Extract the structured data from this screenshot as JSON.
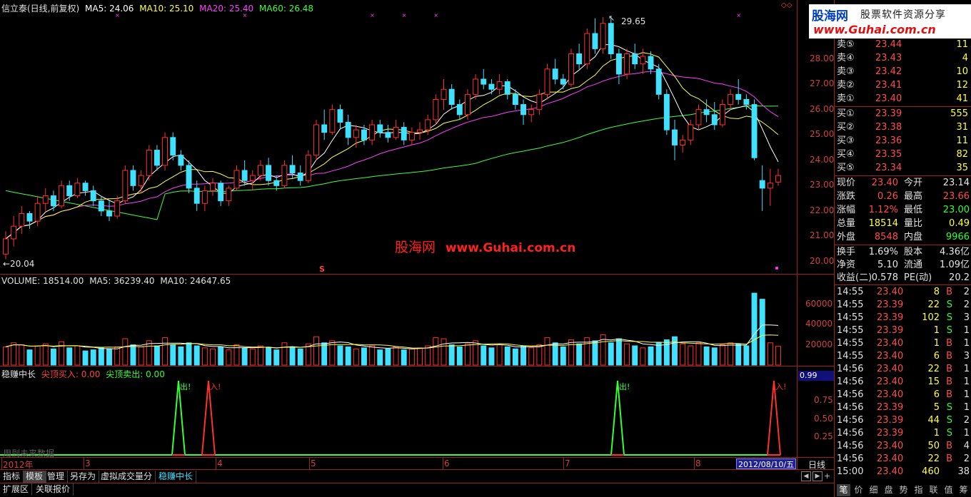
{
  "main_header": {
    "stock_label": "信立泰(日线,前复权)",
    "ma5": "MA5: 24.06",
    "ma10": "MA10: 25.10",
    "ma20": "MA20: 25.40",
    "ma60": "MA60: 26.48"
  },
  "price_annotations": {
    "high": "29.65",
    "low": "←20.04",
    "s_mark": "S"
  },
  "price_axis": [
    "29.00",
    "28.00",
    "27.00",
    "26.00",
    "25.00",
    "24.00",
    "23.00",
    "22.00",
    "21.00",
    "20.00"
  ],
  "volume_header": {
    "volume": "VOLUME: 18514.00",
    "ma5": "MA5: 36239.40",
    "ma10": "MA10: 24647.65"
  },
  "volume_axis": [
    "60000",
    "40000",
    "20000"
  ],
  "indicator_header": {
    "name": "稳赚中长",
    "buy": "尖顶买入: 0.00",
    "sell": "尖顶卖出: 0.00"
  },
  "indicator_axis": {
    "value_box": "0.99",
    "ticks": [
      "0.75",
      "0.50",
      "0.25"
    ]
  },
  "indicator_marks": {
    "out1": "出!",
    "in1": "入!",
    "out2": "出!",
    "in2": "入!"
  },
  "future_data_note": "用到未来数据",
  "date_axis": [
    "2012年",
    "3",
    "4",
    "5",
    "6",
    "7",
    "8"
  ],
  "current_date": "2012/08/10/五",
  "period": "日线",
  "watermark": {
    "cn": "股海网",
    "url": "www.Guhai.com.cn"
  },
  "logo": {
    "brand": "股海网",
    "slogan": "股票软件资源分享",
    "url": "www.Guhai.com.cn"
  },
  "order_book": {
    "sells": [
      {
        "label": "卖⑤",
        "price": "23.44",
        "vol": "11"
      },
      {
        "label": "卖④",
        "price": "23.43",
        "vol": "4"
      },
      {
        "label": "卖③",
        "price": "23.42",
        "vol": "10"
      },
      {
        "label": "卖②",
        "price": "23.41",
        "vol": "12"
      },
      {
        "label": "卖①",
        "price": "23.40",
        "vol": "41"
      }
    ],
    "buys": [
      {
        "label": "买①",
        "price": "23.39",
        "vol": "555"
      },
      {
        "label": "买②",
        "price": "23.38",
        "vol": "31"
      },
      {
        "label": "买③",
        "price": "23.36",
        "vol": "11"
      },
      {
        "label": "买④",
        "price": "23.35",
        "vol": "82"
      },
      {
        "label": "买⑤",
        "price": "23.34",
        "vol": "35"
      }
    ]
  },
  "quote": [
    {
      "l1": "现价",
      "v1": "23.40",
      "l2": "今开",
      "v2": "23.14",
      "c1": "red",
      "c2": "wht"
    },
    {
      "l1": "涨跌",
      "v1": "0.26",
      "l2": "最高",
      "v2": "23.66",
      "c1": "red",
      "c2": "red"
    },
    {
      "l1": "涨幅",
      "v1": "1.12%",
      "l2": "最低",
      "v2": "23.00",
      "c1": "red",
      "c2": "grn"
    },
    {
      "l1": "总量",
      "v1": "18514",
      "l2": "量比",
      "v2": "0.49",
      "c1": "yel",
      "c2": "yel"
    },
    {
      "l1": "外盘",
      "v1": "8548",
      "l2": "内盘",
      "v2": "9966",
      "c1": "red",
      "c2": "grn"
    }
  ],
  "fundamentals": [
    {
      "l1": "换手",
      "v1": "1.69%",
      "l2": "股本",
      "v2": "4.36亿"
    },
    {
      "l1": "净资",
      "v1": "5.10",
      "l2": "流通",
      "v2": "1.09亿"
    },
    {
      "l1": "收益(二)",
      "v1": "0.578",
      "l2": "PE(动)",
      "v2": "20.2"
    }
  ],
  "ticks": [
    {
      "t": "14:55",
      "p": "23.40",
      "v": "8",
      "s": "B",
      "n": "2",
      "pc": "red"
    },
    {
      "t": "14:55",
      "p": "23.39",
      "v": "22",
      "s": "S",
      "n": "2",
      "pc": "red"
    },
    {
      "t": "14:55",
      "p": "23.39",
      "v": "102",
      "s": "S",
      "n": "3",
      "pc": "red"
    },
    {
      "t": "14:55",
      "p": "23.39",
      "v": "1",
      "s": "S",
      "n": "1",
      "pc": "red"
    },
    {
      "t": "14:55",
      "p": "23.40",
      "v": "1",
      "s": "B",
      "n": "1",
      "pc": "red"
    },
    {
      "t": "14:55",
      "p": "23.40",
      "v": "6",
      "s": "B",
      "n": "3",
      "pc": "red"
    },
    {
      "t": "14:56",
      "p": "23.40",
      "v": "22",
      "s": "B",
      "n": "1",
      "pc": "red"
    },
    {
      "t": "14:56",
      "p": "23.40",
      "v": "15",
      "s": "B",
      "n": "1",
      "pc": "red"
    },
    {
      "t": "14:56",
      "p": "23.40",
      "v": "6",
      "s": "B",
      "n": "1",
      "pc": "red"
    },
    {
      "t": "14:56",
      "p": "23.39",
      "v": "5",
      "s": "S",
      "n": "1",
      "pc": "red"
    },
    {
      "t": "14:56",
      "p": "23.39",
      "v": "44",
      "s": "S",
      "n": "2",
      "pc": "red"
    },
    {
      "t": "14:56",
      "p": "23.39",
      "v": "1",
      "s": "S",
      "n": "1",
      "pc": "red"
    },
    {
      "t": "14:56",
      "p": "23.40",
      "v": "50",
      "s": "B",
      "n": "4",
      "pc": "red"
    },
    {
      "t": "14:56",
      "p": "23.40",
      "v": "22",
      "s": "B",
      "n": "2",
      "pc": "red"
    },
    {
      "t": "15:00",
      "p": "23.40",
      "v": "460",
      "s": "",
      "n": "38",
      "pc": "red"
    }
  ],
  "bottom_tabs": [
    "指标",
    "模板",
    "管理",
    "另存为",
    "虚拟成交量分",
    "稳赚中长"
  ],
  "bottom_tabs2": [
    "扩展区",
    "关联报价"
  ],
  "right_tabs": [
    "笔",
    "价",
    "细",
    "盘",
    "势",
    "指",
    "联",
    "值",
    "筹"
  ],
  "colors": {
    "up": "#ff3030",
    "down": "#40e0ff",
    "ma5": "#ffffff",
    "ma10": "#ffff40",
    "ma20": "#ff40ff",
    "ma60": "#40ff40",
    "grid": "#a02020"
  },
  "chart_data": {
    "type": "candlestick",
    "ylim": [
      19.6,
      30.0
    ],
    "candles": [
      [
        20.3,
        21.2,
        20.1,
        20.9
      ],
      [
        20.9,
        21.8,
        20.6,
        21.4
      ],
      [
        21.4,
        22.2,
        21.1,
        21.9
      ],
      [
        21.9,
        22.0,
        21.3,
        21.6
      ],
      [
        21.6,
        22.6,
        21.4,
        22.3
      ],
      [
        22.3,
        22.9,
        22.0,
        22.6
      ],
      [
        22.6,
        22.8,
        22.0,
        22.2
      ],
      [
        22.2,
        23.2,
        22.1,
        23.0
      ],
      [
        23.0,
        23.2,
        22.4,
        22.6
      ],
      [
        22.6,
        23.3,
        22.5,
        23.1
      ],
      [
        23.1,
        23.2,
        22.6,
        22.8
      ],
      [
        22.8,
        23.0,
        22.2,
        22.4
      ],
      [
        22.4,
        22.6,
        21.8,
        22.0
      ],
      [
        22.0,
        22.4,
        21.6,
        21.8
      ],
      [
        21.8,
        22.6,
        21.7,
        22.4
      ],
      [
        22.4,
        23.8,
        22.3,
        23.6
      ],
      [
        23.6,
        23.8,
        22.8,
        23.0
      ],
      [
        23.0,
        23.6,
        22.7,
        23.4
      ],
      [
        23.4,
        24.6,
        23.2,
        24.4
      ],
      [
        24.4,
        24.6,
        23.6,
        23.8
      ],
      [
        23.8,
        25.1,
        23.6,
        24.9
      ],
      [
        24.9,
        25.1,
        24.0,
        24.2
      ],
      [
        24.2,
        24.4,
        23.6,
        23.8
      ],
      [
        23.8,
        24.0,
        22.7,
        22.9
      ],
      [
        22.9,
        23.2,
        22.0,
        22.3
      ],
      [
        22.3,
        23.0,
        22.0,
        22.8
      ],
      [
        22.8,
        23.3,
        22.6,
        23.1
      ],
      [
        23.1,
        23.2,
        22.2,
        22.4
      ],
      [
        22.4,
        23.0,
        22.2,
        22.9
      ],
      [
        22.9,
        23.8,
        22.8,
        23.6
      ],
      [
        23.6,
        24.0,
        23.0,
        23.2
      ],
      [
        23.2,
        23.6,
        22.8,
        23.4
      ],
      [
        23.4,
        24.0,
        23.2,
        23.8
      ],
      [
        23.8,
        24.1,
        23.0,
        23.2
      ],
      [
        23.2,
        23.4,
        22.8,
        23.0
      ],
      [
        23.0,
        24.0,
        22.9,
        23.8
      ],
      [
        23.8,
        24.2,
        23.3,
        23.5
      ],
      [
        23.5,
        23.8,
        23.0,
        23.2
      ],
      [
        23.2,
        24.4,
        23.1,
        24.2
      ],
      [
        24.2,
        25.6,
        24.0,
        25.4
      ],
      [
        25.4,
        26.0,
        24.8,
        25.1
      ],
      [
        25.1,
        26.2,
        25.0,
        26.0
      ],
      [
        26.0,
        26.2,
        25.2,
        25.5
      ],
      [
        25.5,
        25.8,
        24.6,
        24.9
      ],
      [
        24.9,
        25.4,
        24.5,
        25.2
      ],
      [
        25.2,
        25.4,
        24.6,
        24.8
      ],
      [
        24.8,
        25.6,
        24.6,
        25.4
      ],
      [
        25.4,
        25.6,
        24.9,
        25.1
      ],
      [
        25.1,
        25.4,
        24.7,
        24.9
      ],
      [
        24.9,
        25.6,
        24.8,
        25.3
      ],
      [
        25.3,
        25.5,
        24.6,
        24.8
      ],
      [
        24.8,
        25.3,
        24.6,
        25.1
      ],
      [
        25.1,
        25.5,
        24.8,
        25.2
      ],
      [
        25.2,
        25.8,
        25.0,
        25.6
      ],
      [
        25.6,
        26.6,
        25.4,
        26.4
      ],
      [
        26.4,
        27.2,
        26.0,
        26.8
      ],
      [
        26.8,
        27.0,
        26.0,
        26.2
      ],
      [
        26.2,
        26.4,
        25.6,
        25.8
      ],
      [
        25.8,
        26.8,
        25.6,
        26.6
      ],
      [
        26.6,
        27.4,
        26.4,
        27.2
      ],
      [
        27.2,
        27.6,
        26.8,
        27.0
      ],
      [
        27.0,
        27.2,
        26.6,
        26.8
      ],
      [
        26.8,
        27.4,
        26.6,
        27.1
      ],
      [
        27.1,
        27.2,
        26.4,
        26.6
      ],
      [
        26.6,
        26.8,
        26.0,
        26.2
      ],
      [
        26.2,
        26.4,
        25.4,
        25.8
      ],
      [
        25.8,
        26.2,
        25.5,
        26.0
      ],
      [
        26.0,
        26.8,
        25.8,
        26.6
      ],
      [
        26.6,
        27.8,
        26.4,
        27.6
      ],
      [
        27.6,
        28.0,
        27.0,
        27.2
      ],
      [
        27.2,
        27.4,
        26.8,
        27.0
      ],
      [
        27.0,
        28.4,
        26.9,
        28.2
      ],
      [
        28.2,
        28.6,
        27.6,
        27.8
      ],
      [
        27.8,
        29.2,
        27.6,
        29.0
      ],
      [
        29.0,
        29.6,
        28.2,
        28.4
      ],
      [
        28.4,
        29.65,
        28.2,
        29.4
      ],
      [
        29.4,
        29.6,
        28.0,
        28.2
      ],
      [
        28.2,
        28.4,
        27.0,
        27.4
      ],
      [
        27.4,
        28.4,
        27.2,
        28.2
      ],
      [
        28.2,
        28.6,
        27.6,
        27.8
      ],
      [
        27.8,
        28.4,
        27.4,
        28.1
      ],
      [
        28.1,
        28.3,
        27.4,
        27.6
      ],
      [
        27.6,
        27.8,
        26.4,
        26.6
      ],
      [
        26.6,
        26.8,
        25.0,
        25.2
      ],
      [
        25.2,
        25.6,
        24.0,
        24.6
      ],
      [
        24.6,
        25.0,
        24.3,
        24.8
      ],
      [
        24.8,
        25.6,
        24.6,
        25.4
      ],
      [
        25.4,
        26.2,
        25.2,
        26.0
      ],
      [
        26.0,
        26.4,
        25.5,
        25.8
      ],
      [
        25.8,
        26.3,
        25.2,
        25.4
      ],
      [
        25.4,
        26.4,
        25.3,
        26.2
      ],
      [
        26.2,
        26.8,
        26.0,
        26.6
      ],
      [
        26.6,
        27.2,
        26.2,
        26.4
      ],
      [
        26.4,
        26.6,
        26.0,
        26.2
      ],
      [
        26.2,
        26.4,
        24.0,
        24.1
      ],
      [
        23.2,
        23.8,
        22.0,
        22.9
      ],
      [
        22.9,
        23.66,
        22.2,
        23.1
      ],
      [
        23.14,
        23.66,
        23.0,
        23.4
      ]
    ],
    "volume": [
      18000,
      22000,
      20000,
      15000,
      19000,
      21000,
      16000,
      23000,
      17000,
      19000,
      14000,
      15000,
      17000,
      16000,
      18000,
      26000,
      20000,
      18000,
      24000,
      19000,
      27000,
      20000,
      18000,
      22000,
      19000,
      17000,
      16000,
      18000,
      15000,
      20000,
      17000,
      16000,
      19000,
      17000,
      15000,
      22000,
      18000,
      16000,
      21000,
      28000,
      22000,
      24000,
      19000,
      18000,
      16000,
      17000,
      19000,
      15000,
      16000,
      18000,
      15000,
      16000,
      17000,
      19000,
      27000,
      26000,
      20000,
      18000,
      21000,
      24000,
      19000,
      17000,
      20000,
      18000,
      16000,
      19000,
      17000,
      20000,
      27000,
      22000,
      18000,
      25000,
      21000,
      27000,
      24000,
      30000,
      22000,
      26000,
      21000,
      19000,
      17000,
      18000,
      22000,
      25000,
      28000,
      21000,
      19000,
      22000,
      18000,
      17000,
      20000,
      22000,
      21000,
      19000,
      71000,
      65000,
      22000,
      18514
    ],
    "indicator": {
      "sell_peaks": [
        8,
        31
      ],
      "buy_peaks": [
        10,
        40
      ]
    }
  }
}
